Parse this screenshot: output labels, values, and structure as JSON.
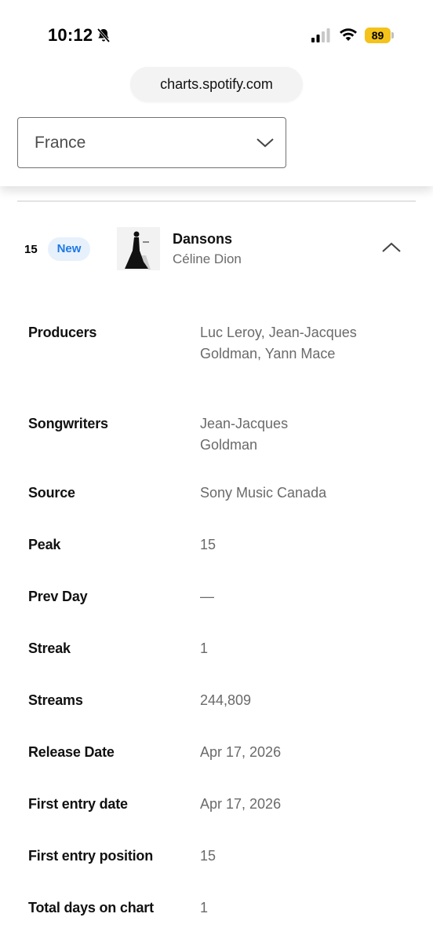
{
  "status_bar": {
    "time": "10:12",
    "battery": "89",
    "battery_color": "#f4c21a"
  },
  "browser": {
    "url": "charts.spotify.com"
  },
  "filter": {
    "country": "France"
  },
  "track": {
    "rank": "15",
    "badge": "New",
    "title": "Dansons",
    "artist": "Céline Dion"
  },
  "details": {
    "producers_label": "Producers",
    "producers_value": "Luc Leroy, Jean-Jacques Goldman, Yann Mace",
    "songwriters_label": "Songwriters",
    "songwriters_value": "Jean-Jacques Goldman",
    "source_label": "Source",
    "source_value": "Sony Music Canada",
    "peak_label": "Peak",
    "peak_value": "15",
    "prev_day_label": "Prev Day",
    "prev_day_value": "—",
    "streak_label": "Streak",
    "streak_value": "1",
    "streams_label": "Streams",
    "streams_value": "244,809",
    "release_date_label": "Release Date",
    "release_date_value": "Apr 17, 2026",
    "first_entry_date_label": "First entry date",
    "first_entry_date_value": "Apr 17, 2026",
    "first_entry_position_label": "First entry position",
    "first_entry_position_value": "15",
    "total_days_label": "Total days on chart",
    "total_days_value": "1"
  },
  "colors": {
    "badge_bg": "#e7f1fc",
    "badge_text": "#1e78e6",
    "muted_text": "#6a6a6a"
  }
}
